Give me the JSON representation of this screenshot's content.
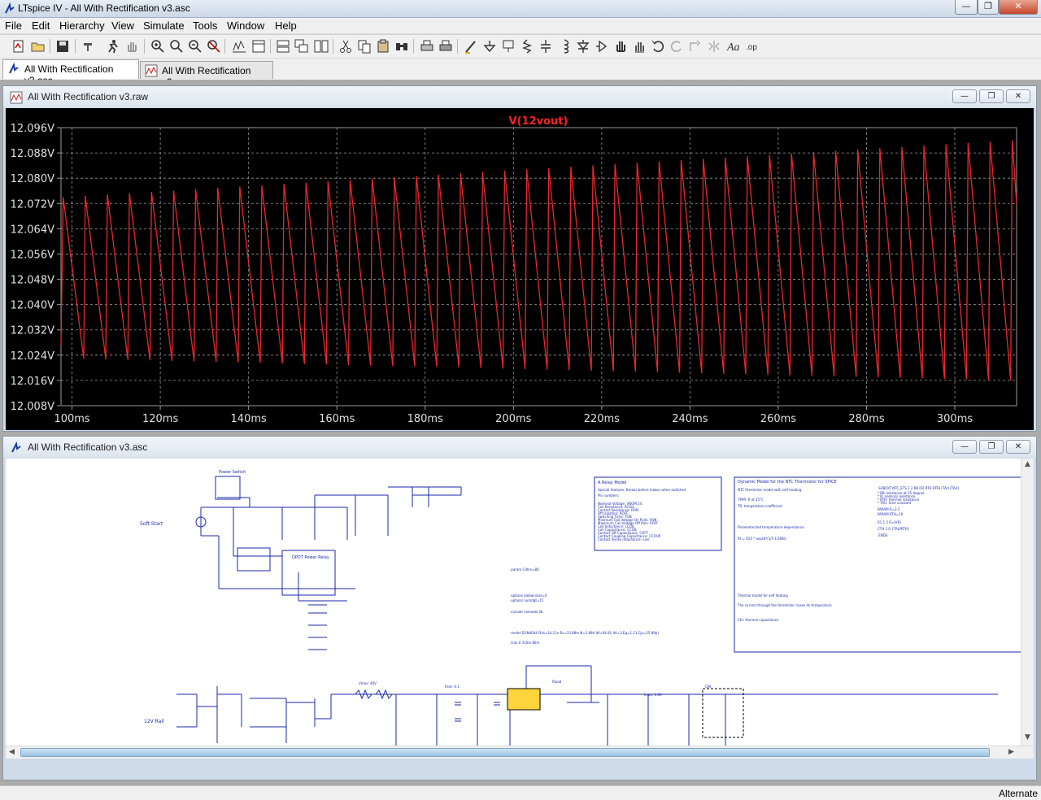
{
  "window": {
    "title": "LTspice IV - All With Rectification v3.asc",
    "minimize": "—",
    "maximize": "❐",
    "close": "✕"
  },
  "menu": [
    "File",
    "Edit",
    "Hierarchy",
    "View",
    "Simulate",
    "Tools",
    "Window",
    "Help"
  ],
  "toolbar_icons": [
    "new-schematic-icon",
    "open-icon",
    "save-icon",
    "control-panel-icon",
    "run-icon",
    "halt-icon",
    "zoom-in-icon",
    "zoom-area-icon",
    "zoom-out-icon",
    "zoom-cancel-icon",
    "autorange-icon",
    "tile-vertical-icon",
    "cascade-icon",
    "tile-horizontal-icon",
    "cut-icon",
    "copy-icon",
    "paste-icon",
    "find-icon",
    "print-setup-icon",
    "print-icon",
    "draw-wire-icon",
    "ground-icon",
    "label-net-icon",
    "resistor-icon",
    "capacitor-icon",
    "inductor-icon",
    "diode-icon",
    "component-icon",
    "move-icon",
    "drag-icon",
    "undo-icon",
    "redo-icon",
    "rotate-icon",
    "mirror-icon",
    "text-icon",
    "spice-directive-icon"
  ],
  "tabs": [
    {
      "label": "All With Rectification v3.asc",
      "icon": "schematic-icon",
      "active": true
    },
    {
      "label": "All With Rectification v3.raw",
      "icon": "waveform-icon",
      "active": false
    }
  ],
  "plot_window": {
    "title": "All With Rectification v3.raw",
    "buttons": [
      "—",
      "❐",
      "✕"
    ]
  },
  "schematic_window": {
    "title": "All With Rectification v3.asc",
    "buttons": [
      "—",
      "❐",
      "✕"
    ]
  },
  "status": {
    "text": "Alternate"
  },
  "colors": {
    "trace": "#e8282d",
    "plot_bg": "#000000",
    "grid": "#9a9a9a",
    "axis_text": "#e0e0e0",
    "title_text": "#ff2020",
    "schematic_wire": "#1a2aa8"
  },
  "chart_data": {
    "type": "line",
    "title": "V(12vout)",
    "xlabel": "",
    "ylabel": "",
    "xlim": [
      97.5,
      314
    ],
    "ylim": [
      12.008,
      12.096
    ],
    "x_ticks": [
      "100ms",
      "120ms",
      "140ms",
      "160ms",
      "180ms",
      "200ms",
      "220ms",
      "240ms",
      "260ms",
      "280ms",
      "300ms"
    ],
    "x_tick_values": [
      100,
      120,
      140,
      160,
      180,
      200,
      220,
      240,
      260,
      280,
      300
    ],
    "y_ticks": [
      "12.096V",
      "12.088V",
      "12.080V",
      "12.072V",
      "12.064V",
      "12.056V",
      "12.048V",
      "12.040V",
      "12.032V",
      "12.024V",
      "12.016V",
      "12.008V"
    ],
    "y_tick_values": [
      12.096,
      12.088,
      12.08,
      12.072,
      12.064,
      12.056,
      12.048,
      12.04,
      12.032,
      12.024,
      12.016,
      12.008
    ],
    "grid": true,
    "series": [
      {
        "name": "V(12vout)",
        "period_ms": 5.0,
        "first_peak_ms": 98.0,
        "last_peak_ms": 313.0,
        "peak_start": 12.074,
        "peak_end": 12.092,
        "trough_start": 12.023,
        "trough_end": 12.016,
        "end": [
          314.0,
          12.072
        ]
      }
    ]
  },
  "schematic_text": {
    "soft_start": "Soft Start",
    "rail_12v": "12V Rail",
    "power_switch": "Power Switch",
    "relay": "DPDT Power Relay",
    "notes1_title": "A Relay Model",
    "notes2_title": "Dynamic Model for the NTC Thermistor for SPICE",
    "notes3_title": ".SUBCKT NTC_ETS 1 2 RB [R] RTH [RTH] TAU [TAU]",
    "params": ".param Cdhrs=80",
    "param_lines": [
      ".options plotwinsize=0",
      ".options numdgt=15",
      ".include nomodel.lib",
      ".model D1N4004 D(Is=14.11n Rs=33.89m N=1.984 Ikf=94.81 Xti=3 Eg=1.11 Cjo=25.89p)",
      ".tran 0 310m 80m"
    ],
    "notes1_lines": [
      "Special features: Breaks before makes when switched.",
      "Pin numbers:",
      "Nominal Voltage: VNOM 24",
      "Coil Resistance: RCOIL",
      "Contact Resistance: RON",
      "Off Isolation: ROFF",
      "Switching Time: TON",
      "Minimum Coil Voltage On Pulls: VON",
      "Maximum Coil Voltage Off Rels: VOFF",
      "Coil Inductance: LCOIL",
      "Coil Capacitance: CCOIL",
      "Contact Off Capacitance: COFF",
      "Contact Coupling Capacitance: CCOUP",
      "Contact Series Inductance: Lser"
    ],
    "notes2_lines": [
      "NTC thermistor model with self heating",
      "TPAR: R at 25°C",
      "TR: temperature coefficient",
      "Parameterized temperature dependance:",
      "Rt = R25 * exp(B*(1/T-1/298))",
      "Thermal model for self heating",
      "The current through the thermistor raises its temperature",
      "Cth: thermal capacitance"
    ],
    "notes3_lines": [
      "* RB resistance at 25 degree",
      "* R: nominal resistance",
      "* RTH: thermal resistance",
      "* TAU: time constant",
      "PARAM R=2.2",
      "PARAM RTH=10",
      "R1 1 3 R=V(R)",
      "CTH 3 0 {TAU/RTH}",
      ".ENDS"
    ],
    "rail_notes": [
      "Vmax: 40V",
      "Rser: 0.1",
      "Rload",
      "Imax: 1.8A",
      "CIN"
    ]
  }
}
